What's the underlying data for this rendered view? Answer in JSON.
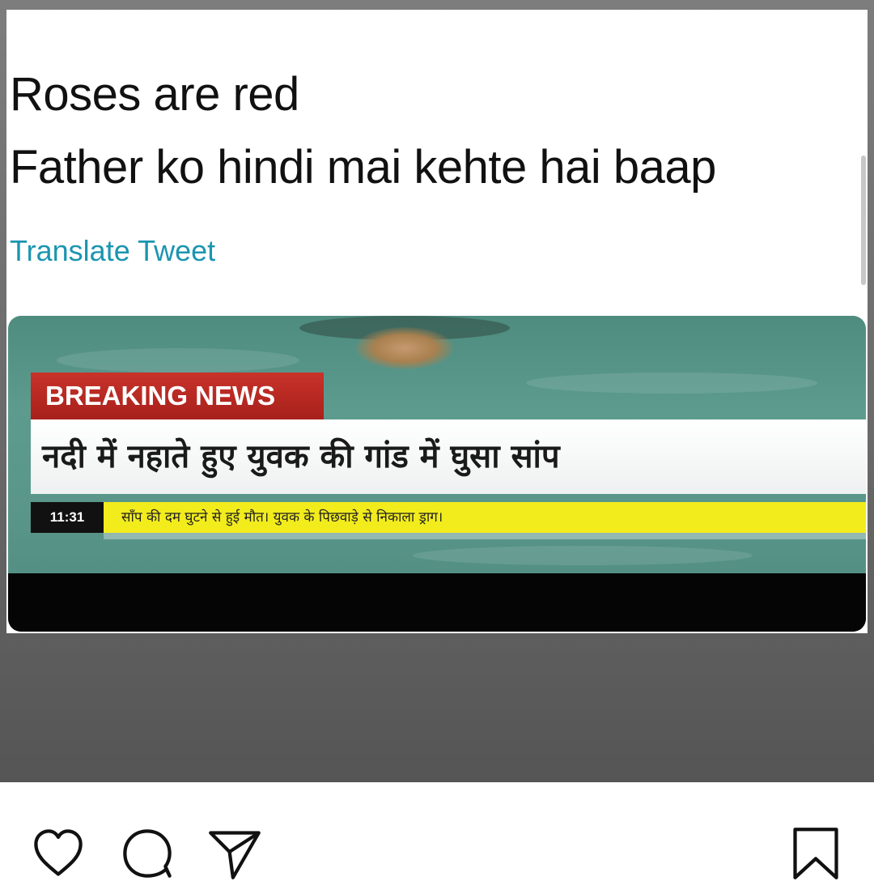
{
  "tweet": {
    "line1": "Roses are red",
    "line2": "Father ko hindi mai kehte hai baap",
    "translate_link": "Translate Tweet"
  },
  "news_image": {
    "badge": "BREAKING NEWS",
    "headline": "नदी में नहाते हुए युवक की गांड में घुसा सांप",
    "ticker_time": "11:31",
    "ticker_text": "साँप की दम घुटने से हुई मौत। युवक के पिछवाड़े से निकाला ड्राग।",
    "colors": {
      "badge_red": "#b8261f",
      "ticker_yellow": "#f2ec1d",
      "water_green": "#5a968a"
    }
  },
  "actions": {
    "icons": [
      "heart-icon",
      "comment-icon",
      "share-icon",
      "bookmark-icon"
    ]
  },
  "colors": {
    "link": "#1b95b0",
    "text": "#111111"
  }
}
